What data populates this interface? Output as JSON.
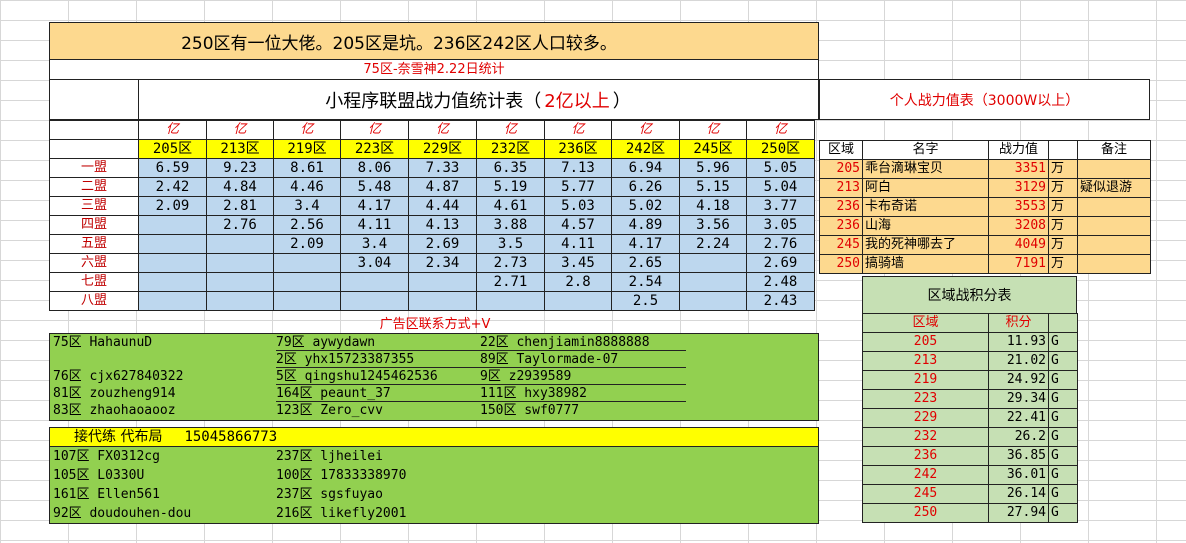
{
  "banner": "250区有一位大佬。205区是坑。236区242区人口较多。",
  "subtitle": "75区-奈雪神2.22日统计",
  "title": {
    "main": "小程序联盟战力值统计表（",
    "highlight": "2亿以上",
    "end": "）"
  },
  "personal_title": "个人战力值表（3000W以上）",
  "unit_yi": "亿",
  "zones": [
    "205区",
    "213区",
    "219区",
    "223区",
    "229区",
    "232区",
    "236区",
    "242区",
    "245区",
    "250区"
  ],
  "alliances": [
    {
      "name": "一盟",
      "values": [
        "6.59",
        "9.23",
        "8.61",
        "8.06",
        "7.33",
        "6.35",
        "7.13",
        "6.94",
        "5.96",
        "5.05"
      ]
    },
    {
      "name": "二盟",
      "values": [
        "2.42",
        "4.84",
        "4.46",
        "5.48",
        "4.87",
        "5.19",
        "5.77",
        "6.26",
        "5.15",
        "5.04"
      ]
    },
    {
      "name": "三盟",
      "values": [
        "2.09",
        "2.81",
        "3.4",
        "4.17",
        "4.44",
        "4.61",
        "5.03",
        "5.02",
        "4.18",
        "3.77"
      ]
    },
    {
      "name": "四盟",
      "values": [
        "",
        "2.76",
        "2.56",
        "4.11",
        "4.13",
        "3.88",
        "4.57",
        "4.89",
        "3.56",
        "3.05"
      ]
    },
    {
      "name": "五盟",
      "values": [
        "",
        "",
        "2.09",
        "3.4",
        "2.69",
        "3.5",
        "4.11",
        "4.17",
        "2.24",
        "2.76"
      ]
    },
    {
      "name": "六盟",
      "values": [
        "",
        "",
        "",
        "3.04",
        "2.34",
        "2.73",
        "3.45",
        "2.65",
        "",
        "2.69"
      ]
    },
    {
      "name": "七盟",
      "values": [
        "",
        "",
        "",
        "",
        "",
        "2.71",
        "2.8",
        "2.54",
        "",
        "2.48"
      ]
    },
    {
      "name": "八盟",
      "values": [
        "",
        "",
        "",
        "",
        "",
        "",
        "",
        "2.5",
        "",
        "2.43"
      ]
    }
  ],
  "personal": {
    "headers": {
      "zone": "区域",
      "name": "名字",
      "power": "战力值",
      "note": "备注"
    },
    "rows": [
      {
        "zone": "205",
        "name": "乖台滴琳宝贝",
        "power": "3351",
        "unit": "万",
        "note": ""
      },
      {
        "zone": "213",
        "name": "阿白",
        "power": "3129",
        "unit": "万",
        "note": "疑似退游"
      },
      {
        "zone": "236",
        "name": "卡布奇诺",
        "power": "3553",
        "unit": "万",
        "note": ""
      },
      {
        "zone": "236",
        "name": "山海",
        "power": "3208",
        "unit": "万",
        "note": ""
      },
      {
        "zone": "245",
        "name": "我的死神哪去了",
        "power": "4049",
        "unit": "万",
        "note": ""
      },
      {
        "zone": "250",
        "name": "搞骑墙",
        "power": "7191",
        "unit": "万",
        "note": ""
      }
    ]
  },
  "score": {
    "title": "区域战积分表",
    "headers": {
      "zone": "区域",
      "score": "积分"
    },
    "rows": [
      {
        "zone": "205",
        "score": "11.93",
        "unit": "G"
      },
      {
        "zone": "213",
        "score": "21.02",
        "unit": "G"
      },
      {
        "zone": "219",
        "score": "24.92",
        "unit": "G"
      },
      {
        "zone": "223",
        "score": "29.34",
        "unit": "G"
      },
      {
        "zone": "229",
        "score": "22.41",
        "unit": "G"
      },
      {
        "zone": "232",
        "score": "26.2",
        "unit": "G"
      },
      {
        "zone": "236",
        "score": "36.85",
        "unit": "G"
      },
      {
        "zone": "242",
        "score": "36.01",
        "unit": "G"
      },
      {
        "zone": "245",
        "score": "26.14",
        "unit": "G"
      },
      {
        "zone": "250",
        "score": "27.94",
        "unit": "G"
      }
    ]
  },
  "ads": {
    "title": "广告区联系方式+V",
    "rows": [
      [
        "75区   HahaunuD",
        "79区   aywydawn",
        "22区  chenjiamin8888888"
      ],
      [
        "",
        "2区   yhx15723387355",
        "89区   Taylormade-07"
      ],
      [
        "76区   cjx627840322",
        "5区  qingshu1245462536",
        "9区   z2939589"
      ],
      [
        "81区   zouzheng914",
        "164区  peaunt_37",
        "111区  hxy38982"
      ],
      [
        "83区   zhaohaoaooz",
        "123区  Zero_cvv",
        "150区  swf0777"
      ]
    ],
    "yellow": {
      "text": "接代练  代布局",
      "phone": "15045866773"
    },
    "rows2": [
      [
        "107区   FX0312cg",
        "237区   ljheilei"
      ],
      [
        "105区 L0330U",
        "100区   17833338970"
      ],
      [
        "161区 Ellen561",
        "237区   sgsfuyao"
      ],
      [
        "92区   doudouhen-dou",
        "216区   likefly2001"
      ]
    ]
  }
}
